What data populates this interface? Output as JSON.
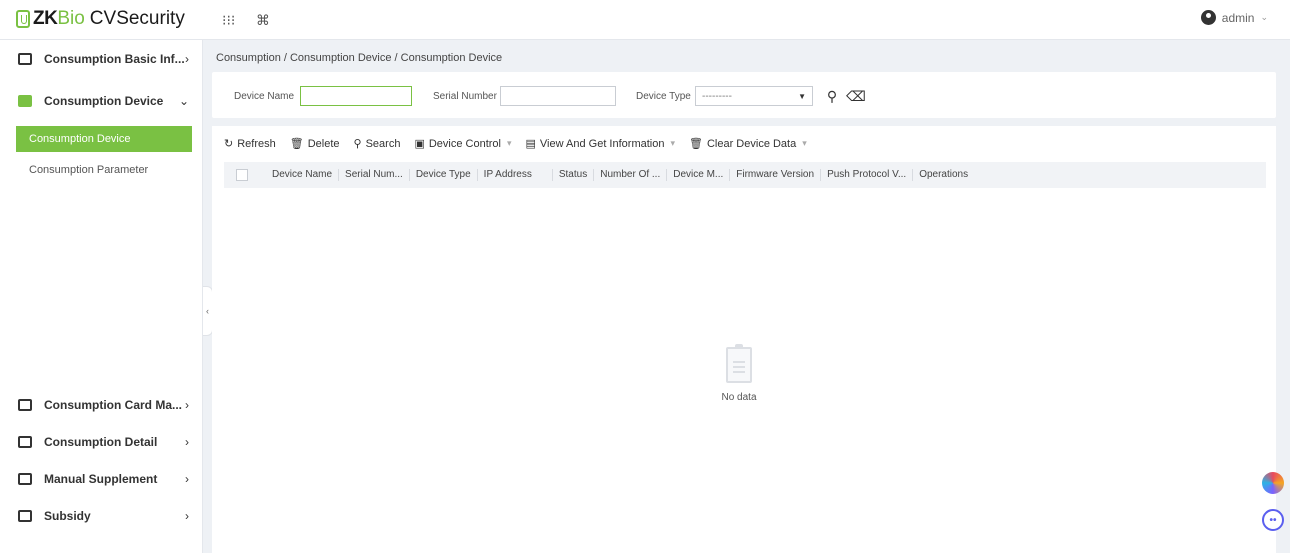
{
  "app": {
    "logo_zk": "ZK",
    "logo_bio": "Bio",
    "logo_cv": "CVSecurity",
    "apps_icon": "grid-icon",
    "shortcut_icon": "command-icon",
    "user": "admin"
  },
  "sidebar": {
    "items": [
      {
        "label": "Consumption Basic Inf...",
        "icon": "calendar-icon",
        "arrow": "›"
      },
      {
        "label": "Consumption Device",
        "icon": "device-icon",
        "arrow": "⌄"
      },
      {
        "label": "Consumption Card Ma...",
        "icon": "card-icon",
        "arrow": "›"
      },
      {
        "label": "Consumption Detail",
        "icon": "detail-icon",
        "arrow": "›"
      },
      {
        "label": "Manual Supplement",
        "icon": "supplement-icon",
        "arrow": "›"
      },
      {
        "label": "Subsidy",
        "icon": "subsidy-icon",
        "arrow": "›"
      }
    ],
    "sub_items": [
      {
        "label": "Consumption Device"
      },
      {
        "label": "Consumption Parameter"
      }
    ]
  },
  "breadcrumb": "Consumption / Consumption Device / Consumption Device",
  "filter": {
    "device_name_label": "Device Name",
    "device_name_value": "",
    "serial_number_label": "Serial Number",
    "serial_number_value": "",
    "device_type_label": "Device Type",
    "device_type_value": "---------",
    "search_icon": "search-icon",
    "clear_icon": "eraser-icon"
  },
  "toolbar": {
    "refresh": "Refresh",
    "delete": "Delete",
    "search": "Search",
    "device_control": "Device Control",
    "view_info": "View And Get Information",
    "clear_data": "Clear Device Data"
  },
  "table": {
    "columns": [
      "Device Name",
      "Serial Num...",
      "Device Type",
      "IP Address",
      "Status",
      "Number Of ...",
      "Device M...",
      "Firmware Version",
      "Push Protocol V...",
      "Operations"
    ],
    "rows": [],
    "empty_text": "No data"
  },
  "colors": {
    "accent": "#7ac143",
    "background": "#eef1f5"
  }
}
